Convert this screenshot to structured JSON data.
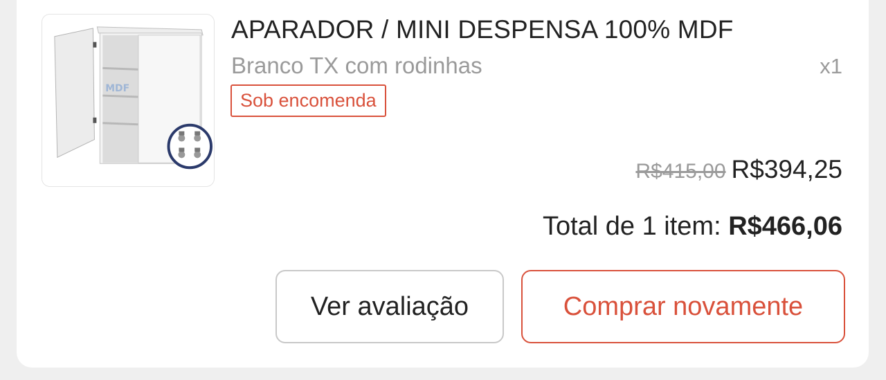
{
  "product": {
    "title": "APARADOR / MINI DESPENSA 100% MDF",
    "variant": "Branco TX com rodinhas",
    "quantity": "x1",
    "badge": "Sob encomenda",
    "image_watermark": "MDF"
  },
  "pricing": {
    "original_price": "R$415,00",
    "sale_price": "R$394,25"
  },
  "total": {
    "label": "Total de 1 item:",
    "value": "R$466,06"
  },
  "actions": {
    "review_label": "Ver avaliação",
    "buy_again_label": "Comprar novamente"
  },
  "colors": {
    "accent": "#d9513b",
    "text": "#222222",
    "muted": "#9a9a9a"
  }
}
